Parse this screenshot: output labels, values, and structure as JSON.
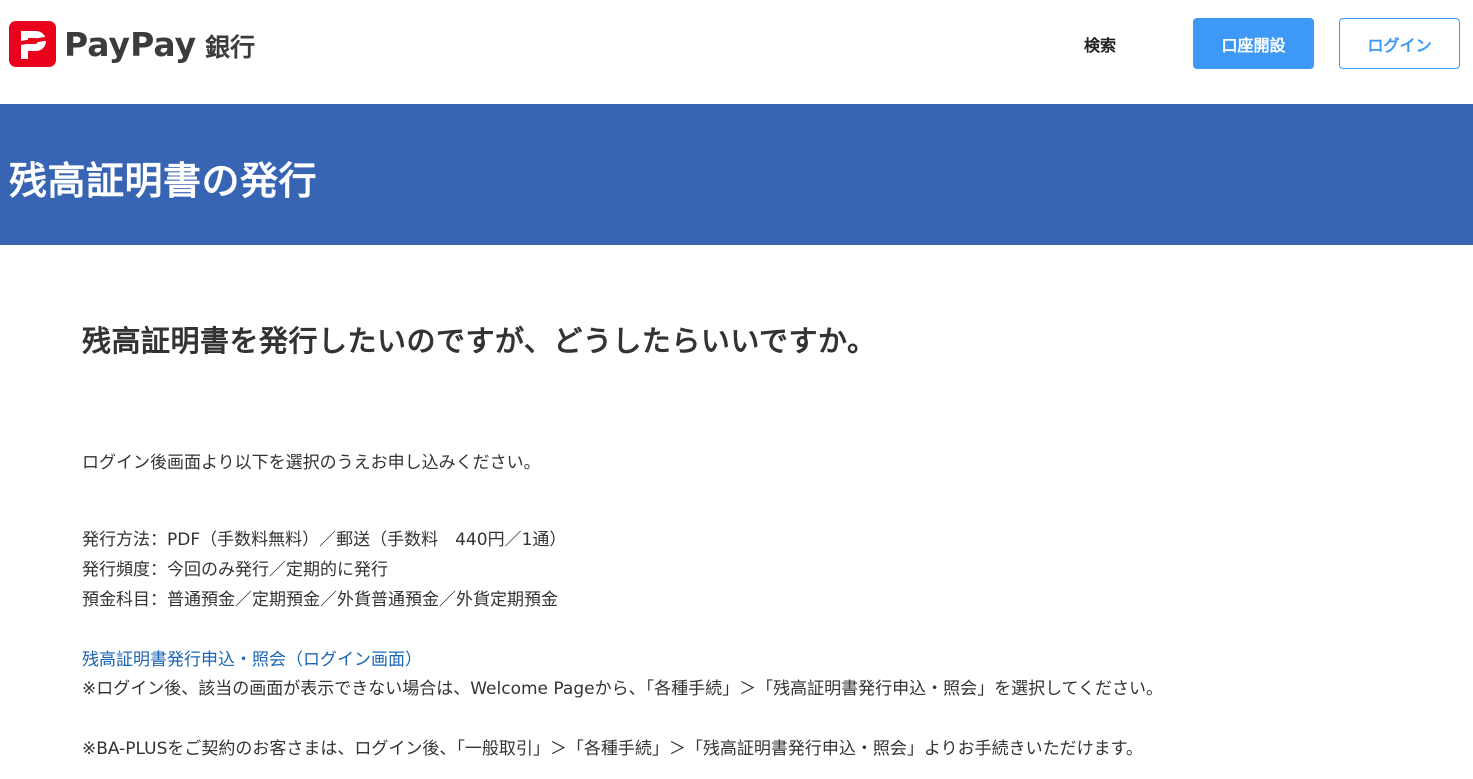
{
  "header": {
    "brand": "PayPay",
    "brand_suffix": "銀行",
    "search_label": "検索",
    "open_account_label": "口座開設",
    "login_label": "ログイン"
  },
  "hero": {
    "title": "残高証明書の発行"
  },
  "main": {
    "question": "残高証明書を発行したいのですが、どうしたらいいですか。",
    "intro": "ログイン後画面より以下を選択のうえお申し込みください。",
    "details": [
      "発行方法：PDF（手数料無料）／郵送（手数料　440円／1通）",
      "発行頻度：今回のみ発行／定期的に発行",
      "預金科目：普通預金／定期預金／外貨普通預金／外貨定期預金"
    ],
    "link_text": "残高証明書発行申込・照会（ログイン画面）",
    "note1": "※ログイン後、該当の画面が表示できない場合は、Welcome Pageから、「各種手続」＞「残高証明書発行申込・照会」を選択してください。",
    "note2": "※BA-PLUSをご契約のお客さまは、ログイン後、「一般取引」＞「各種手続」＞「残高証明書発行申込・照会」よりお手続きいただけます。"
  },
  "colors": {
    "brand_red": "#e8001c",
    "hero_blue": "#3765b3",
    "button_blue": "#3e98f5",
    "link_blue": "#1a64b7"
  },
  "icons": {
    "logo": "paypay-logo-icon"
  }
}
